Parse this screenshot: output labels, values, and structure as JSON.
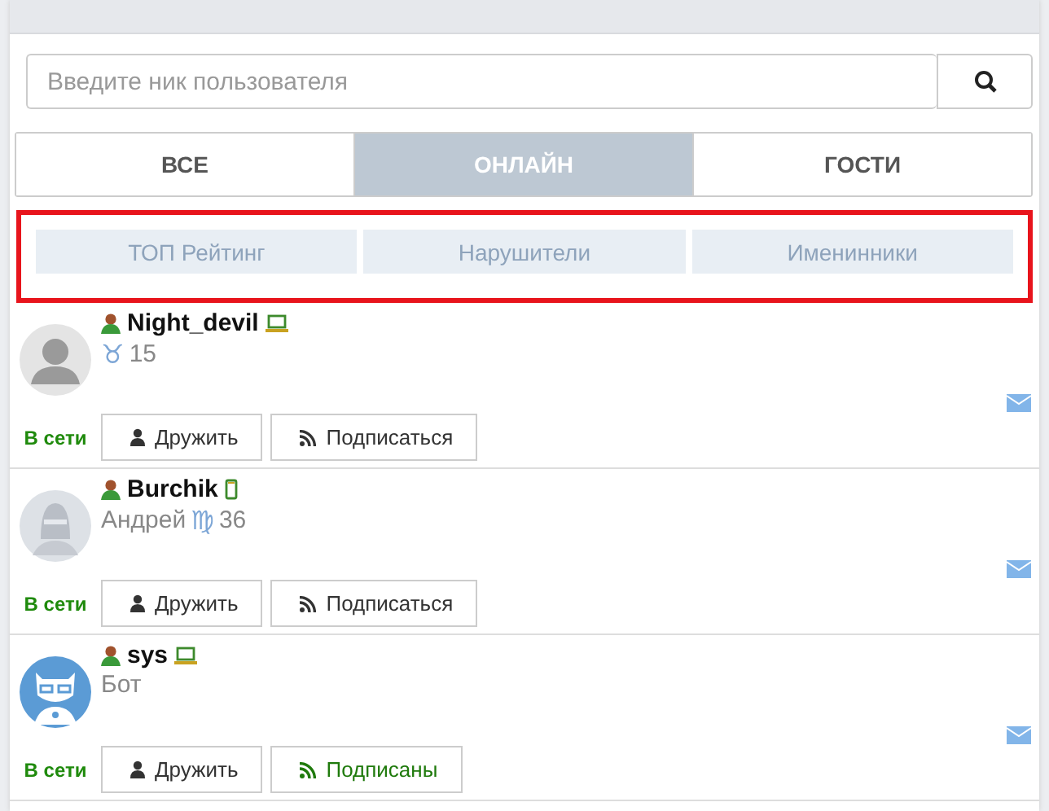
{
  "search": {
    "placeholder": "Введите ник пользователя"
  },
  "tabs": [
    {
      "label": "ВСЕ",
      "selected": false
    },
    {
      "label": "ОНЛАЙН",
      "selected": true
    },
    {
      "label": "ГОСТИ",
      "selected": false
    }
  ],
  "filters": [
    {
      "label": "ТОП Рейтинг"
    },
    {
      "label": "Нарушители"
    },
    {
      "label": "Именинники"
    }
  ],
  "users": [
    {
      "name": "Night_devil",
      "device": {
        "kind": "laptop"
      },
      "avatar": {
        "kind": "default"
      },
      "zodiac": "♉",
      "age": "15",
      "status": "В сети",
      "friend_label": "Дружить",
      "subscribe_label": "Подписаться",
      "subscribed": false
    },
    {
      "name": "Burchik",
      "device": {
        "kind": "phone"
      },
      "real_name": "Андрей",
      "zodiac": "♍",
      "age": "36",
      "status": "В сети",
      "friend_label": "Дружить",
      "subscribe_label": "Подписаться",
      "subscribed": false
    },
    {
      "name": "sys",
      "device": {
        "kind": "laptop"
      },
      "avatar": {
        "kind": "bot"
      },
      "real_name": "Бот",
      "status": "В сети",
      "friend_label": "Дружить",
      "subscribe_label": "Подписаны",
      "subscribed": true
    }
  ]
}
